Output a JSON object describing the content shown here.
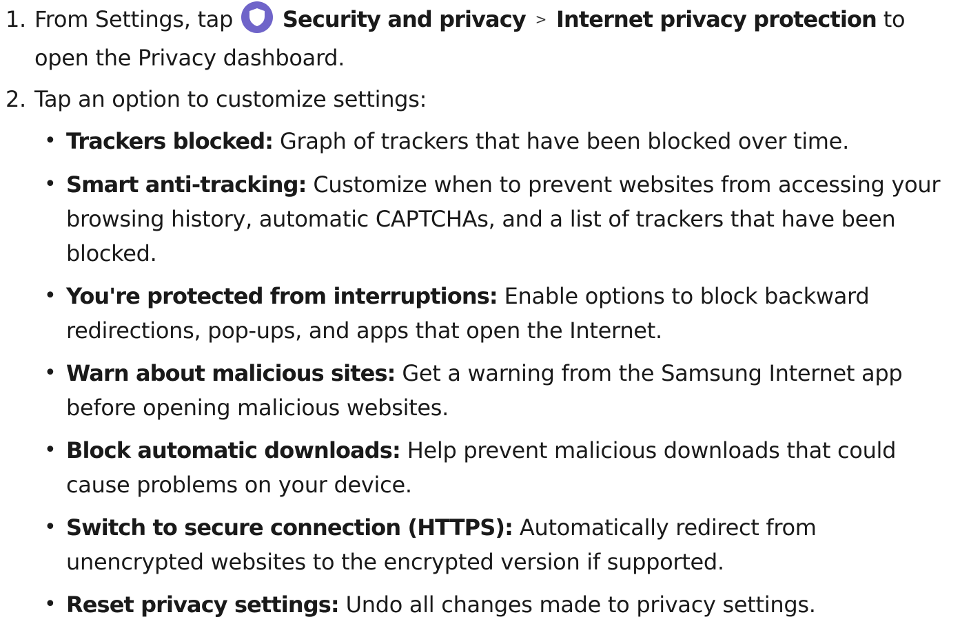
{
  "steps": [
    {
      "number": "1.",
      "prefix": "From Settings, tap",
      "icon": "shield-icon",
      "link1": "Security and privacy",
      "separator": ">",
      "link2": "Internet privacy protection",
      "suffix_line1": "to open",
      "suffix_line2": "the Privacy dashboard."
    },
    {
      "number": "2.",
      "text": "Tap an option to customize settings:"
    }
  ],
  "bullets": [
    {
      "term": "Trackers blocked:",
      "description": "Graph of trackers that have been blocked over time."
    },
    {
      "term": "Smart anti-tracking:",
      "description": "Customize when to prevent websites from accessing your browsing history, automatic CAPTCHAs, and a list of trackers that have been blocked."
    },
    {
      "term": "You're protected from interruptions:",
      "description": "Enable options to block backward redirections, pop-ups, and apps that open the Internet."
    },
    {
      "term": "Warn about malicious sites:",
      "description": "Get a warning from the Samsung Internet app before opening malicious websites."
    },
    {
      "term": "Block automatic downloads:",
      "description": "Help prevent malicious downloads that could cause problems on your device."
    },
    {
      "term": "Switch to secure connection (HTTPS):",
      "description": "Automatically redirect from unencrypted websites to the encrypted version if supported."
    },
    {
      "term": "Reset privacy settings:",
      "description": "Undo all changes made to privacy settings."
    }
  ],
  "colors": {
    "icon_background": "#6f64c9",
    "text": "#1a1a1a"
  }
}
